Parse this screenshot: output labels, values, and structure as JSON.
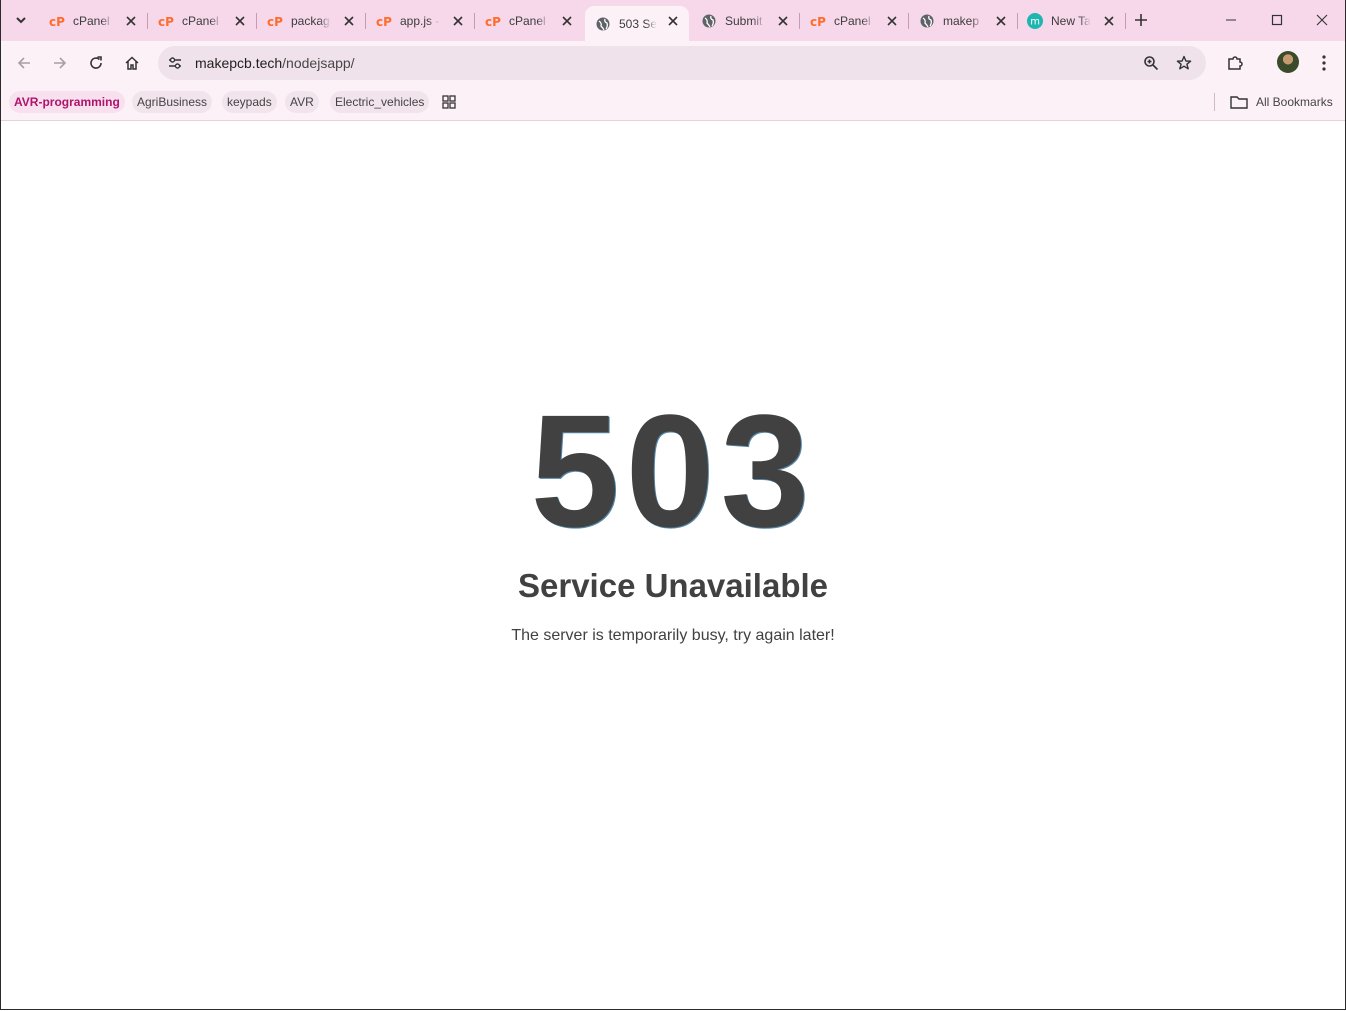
{
  "tabs": [
    {
      "title": "cPanel",
      "favicon": "cpanel-icon",
      "active": false
    },
    {
      "title": "cPanel",
      "favicon": "cpanel-icon",
      "active": false
    },
    {
      "title": "package",
      "favicon": "cpanel-icon",
      "active": false
    },
    {
      "title": "app.js -",
      "favicon": "cpanel-icon",
      "active": false
    },
    {
      "title": "cPanel",
      "favicon": "cpanel-icon",
      "active": false
    },
    {
      "title": "503 Se",
      "favicon": "globe-icon",
      "active": true
    },
    {
      "title": "Submit",
      "favicon": "globe-icon",
      "active": false
    },
    {
      "title": "cPanel",
      "favicon": "cpanel-icon",
      "active": false
    },
    {
      "title": "makep",
      "favicon": "globe-icon",
      "active": false
    },
    {
      "title": "New Ta",
      "favicon": "m-icon",
      "active": false
    }
  ],
  "toolbar": {
    "url_host": "makepcb.tech",
    "url_path": "/nodejsapp/"
  },
  "bookmarks": {
    "items": [
      "AVR-programming",
      "AgriBusiness",
      "keypads",
      "AVR",
      "Electric_vehicles"
    ],
    "all_bookmarks": "All Bookmarks"
  },
  "page": {
    "code": "503",
    "heading": "Service Unavailable",
    "message": "The server is temporarily busy, try again later!"
  },
  "colors": {
    "tabstrip": "#f6d8ea",
    "toolbar": "#fdf1f8",
    "cpanel_orange": "#ff6c2c",
    "text": "#414141"
  }
}
